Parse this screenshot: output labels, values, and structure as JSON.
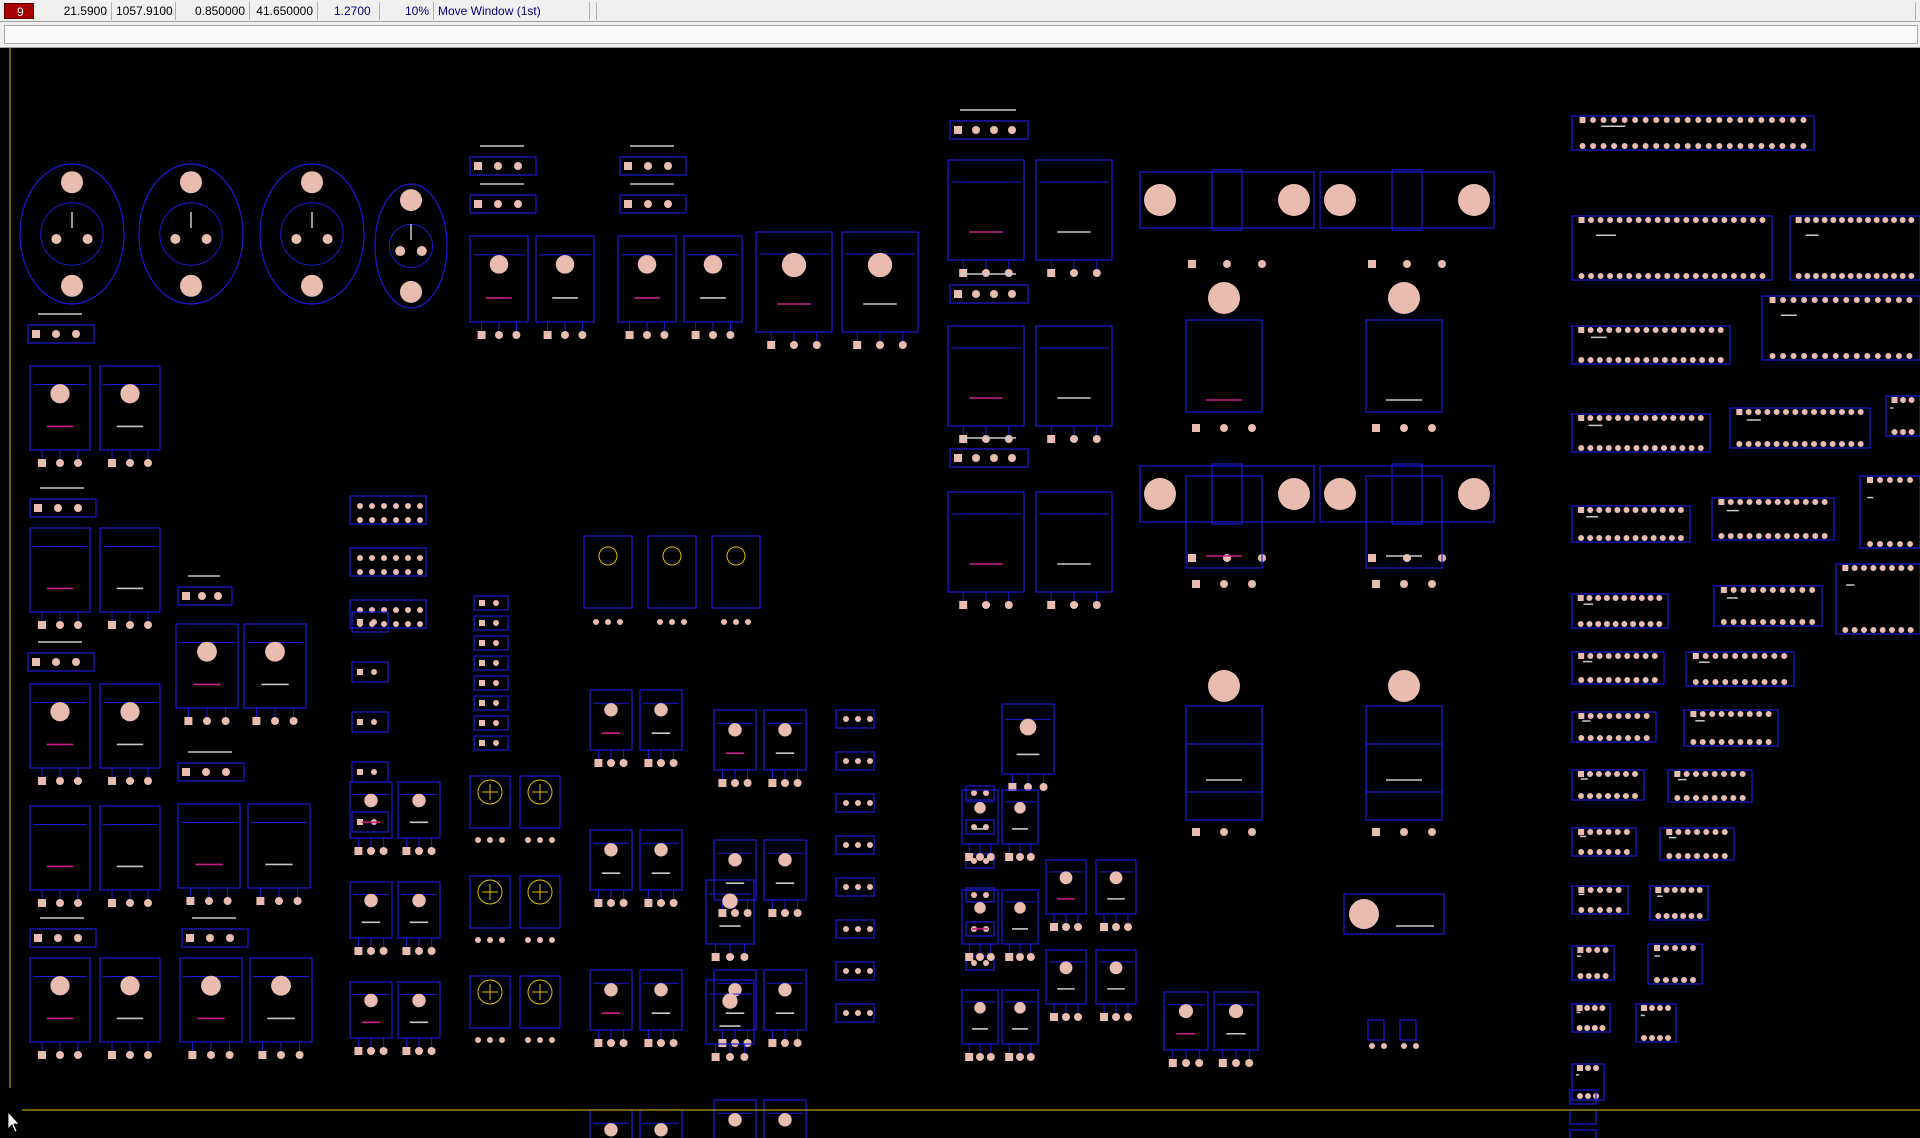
{
  "statusbar": {
    "layer_number": "9",
    "x_coord": "21.5900",
    "y_coord": "1057.9100",
    "dx": "0.850000",
    "dy": "41.650000",
    "grid": "1.2700",
    "zoom": "10%",
    "command": "Move Window (1st)"
  },
  "colors": {
    "background": "#000000",
    "outline": "#1a1ad8",
    "pad": "#e8bcae",
    "silk": "#c8c8c8",
    "marker": "#c8208a",
    "crosshair": "#e0c000"
  },
  "canvas": {
    "name": "pcb-component-library-view",
    "cursor_icon": "arrow-cursor-icon"
  }
}
